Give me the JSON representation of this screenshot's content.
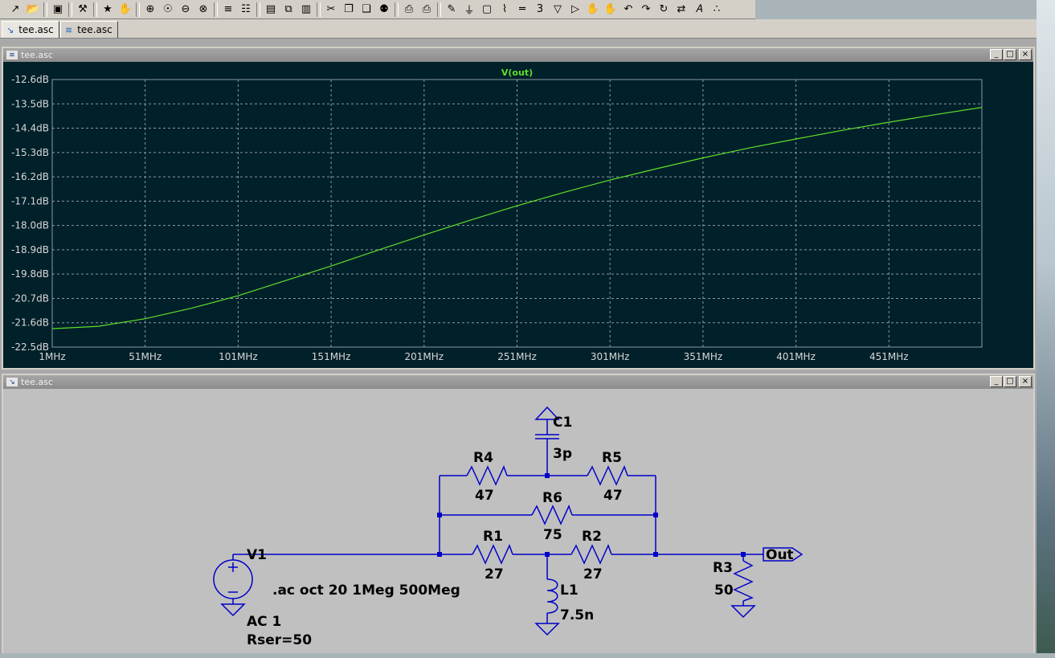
{
  "tabs": [
    {
      "label": "tee.asc",
      "icon": "schematic-icon"
    },
    {
      "label": "tee.asc",
      "icon": "waveform-icon"
    }
  ],
  "plot_window": {
    "title": "tee.asc"
  },
  "schematic_window": {
    "title": "tee.asc"
  },
  "window_buttons": {
    "minimize": "_",
    "restore": "□",
    "close": "×"
  },
  "colors": {
    "plot_bg": "#00202a",
    "trace": "#5ee02a",
    "wire": "#0000c8",
    "schematic_bg": "#c0c0c0"
  },
  "chart_data": {
    "type": "line",
    "title": "",
    "series": [
      {
        "name": "V(out)",
        "color": "#5ee02a",
        "x": [
          1,
          26,
          51,
          76,
          101,
          126,
          151,
          176,
          201,
          226,
          251,
          276,
          301,
          326,
          351,
          376,
          401,
          426,
          451,
          476,
          501
        ],
        "y": [
          -21.82,
          -21.73,
          -21.45,
          -21.06,
          -20.6,
          -20.05,
          -19.5,
          -18.92,
          -18.35,
          -17.8,
          -17.27,
          -16.78,
          -16.32,
          -15.9,
          -15.5,
          -15.13,
          -14.8,
          -14.48,
          -14.18,
          -13.9,
          -13.63
        ]
      }
    ],
    "x_ticks": [
      "1MHz",
      "51MHz",
      "101MHz",
      "151MHz",
      "201MHz",
      "251MHz",
      "301MHz",
      "351MHz",
      "401MHz",
      "451MHz"
    ],
    "x_tick_values": [
      1,
      51,
      101,
      151,
      201,
      251,
      301,
      351,
      401,
      451
    ],
    "xlim": [
      1,
      501
    ],
    "y_ticks": [
      "-12.6dB",
      "-13.5dB",
      "-14.4dB",
      "-15.3dB",
      "-16.2dB",
      "-17.1dB",
      "-18.0dB",
      "-18.9dB",
      "-19.8dB",
      "-20.7dB",
      "-21.6dB",
      "-22.5dB"
    ],
    "y_tick_values": [
      -12.6,
      -13.5,
      -14.4,
      -15.3,
      -16.2,
      -17.1,
      -18.0,
      -18.9,
      -19.8,
      -20.7,
      -21.6,
      -22.5
    ],
    "ylim": [
      -22.5,
      -12.6
    ],
    "grid": true
  },
  "schematic": {
    "components": {
      "C1": {
        "name": "C1",
        "value": "3p"
      },
      "R4": {
        "name": "R4",
        "value": "47"
      },
      "R5": {
        "name": "R5",
        "value": "47"
      },
      "R6": {
        "name": "R6",
        "value": "75"
      },
      "R1": {
        "name": "R1",
        "value": "27"
      },
      "R2": {
        "name": "R2",
        "value": "27"
      },
      "R3": {
        "name": "R3",
        "value": "50"
      },
      "L1": {
        "name": "L1",
        "value": "7.5n"
      },
      "V1": {
        "name": "V1",
        "value": "AC 1",
        "extra": "Rser=50"
      }
    },
    "directive": ".ac oct 20 1Meg 500Meg",
    "out_label": "Out"
  }
}
